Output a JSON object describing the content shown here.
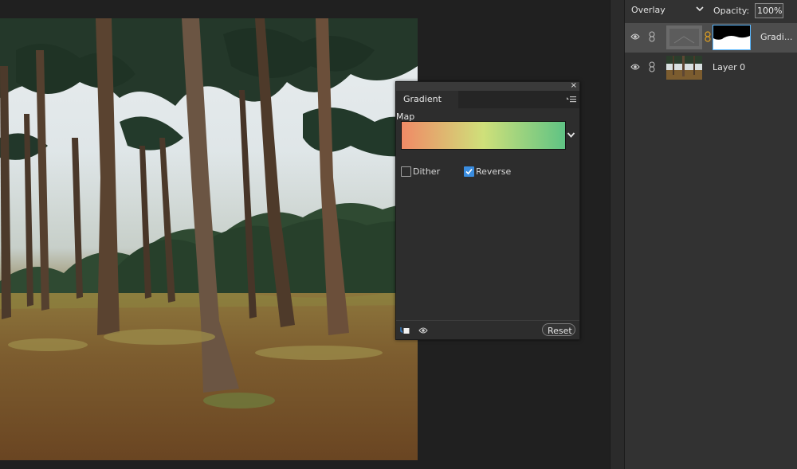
{
  "layers_panel": {
    "blend_mode": "Overlay",
    "opacity_label": "Opacity:",
    "opacity_value": "100%",
    "layers": [
      {
        "name": "Gradi...",
        "selected": true,
        "has_mask": true
      },
      {
        "name": "Layer 0",
        "selected": false,
        "has_mask": false
      }
    ]
  },
  "gradient_map": {
    "tab_label": "Gradient Map",
    "close_glyph": "×",
    "gradient": {
      "start_color": "#f08a66",
      "mid_color": "#cfe07a",
      "end_color": "#5fc384"
    },
    "dither_label": "Dither",
    "dither_checked": false,
    "reverse_label": "Reverse",
    "reverse_checked": true,
    "reset_label": "Reset"
  },
  "colors": {
    "accent": "#3a8de0",
    "panel_bg": "#323232",
    "dialog_bg": "#2d2d2d",
    "selected_layer_bg": "#4d4d4d"
  },
  "icons": [
    "eye-icon",
    "link-icon",
    "chevron-down-icon",
    "panel-menu-icon",
    "close-icon",
    "clip-to-layer-icon",
    "visibility-icon",
    "checkmark-icon"
  ]
}
